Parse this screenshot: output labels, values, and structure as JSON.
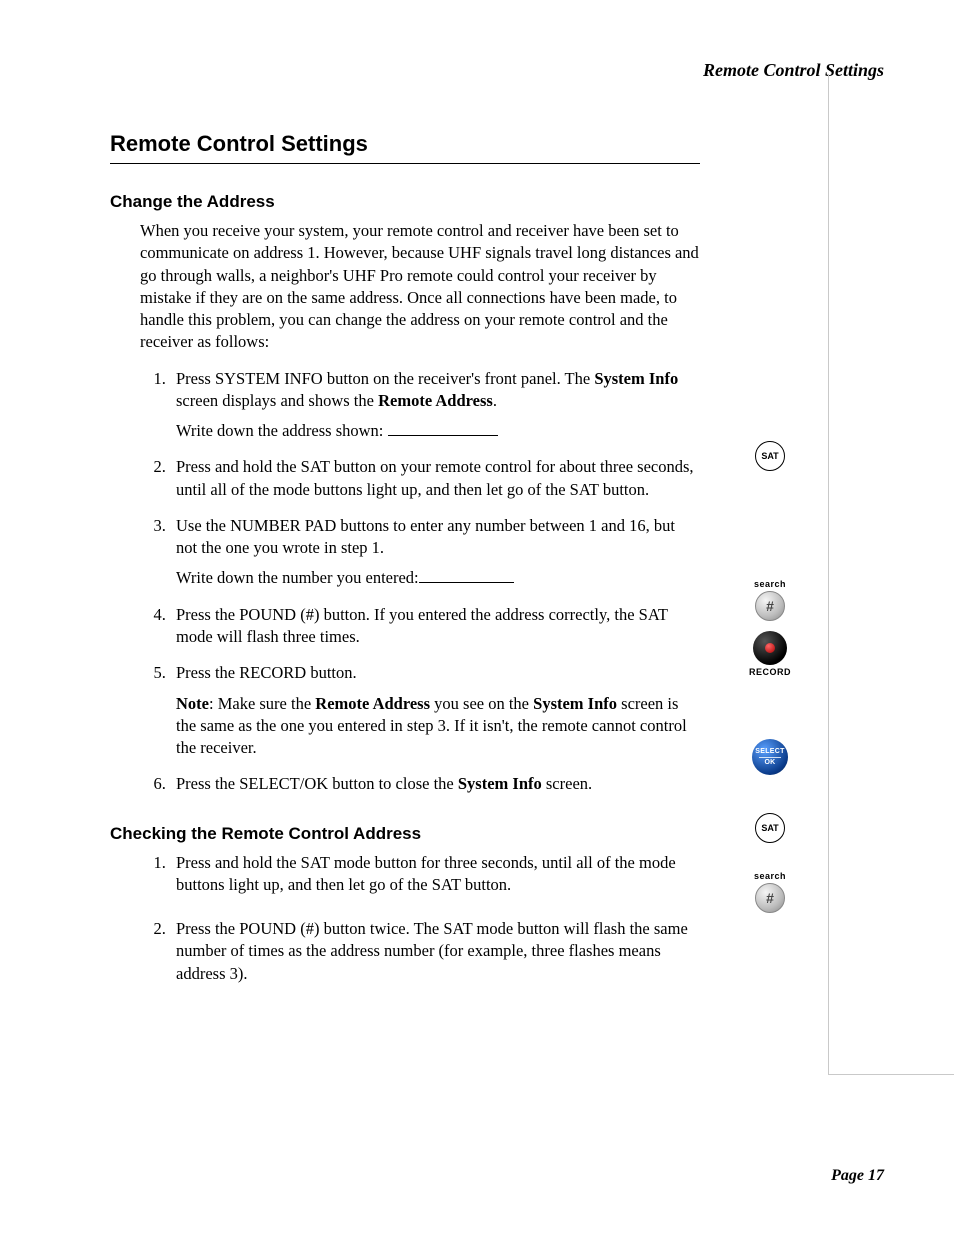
{
  "header": {
    "running": "Remote Control Settings"
  },
  "title": "Remote Control Settings",
  "section1": {
    "heading": "Change the Address",
    "intro": "When you receive your system, your remote control and receiver have been set to communicate on address 1. However, because UHF signals travel long distances and go through walls, a neighbor's UHF Pro remote could control your receiver by mistake if they are on the same address. Once all connections have been made, to handle this problem, you can change the address on your remote control and the receiver as follows:",
    "steps": {
      "s1a": "Press ",
      "s1_sc1": "SYSTEM INFO",
      "s1b": " button on the receiver's front panel. The ",
      "s1_b1": "System Info",
      "s1c": " screen displays and shows the ",
      "s1_b2": "Remote Address",
      "s1d": ".",
      "s1_write": "Write down the address shown: ",
      "s2a": "Press and hold the ",
      "s2_sc1": "SAT",
      "s2b": " button on your remote control for about three seconds, until all of the mode buttons light up, and then let go of the ",
      "s2_sc2": "SAT",
      "s2c": " button.",
      "s3a": "Use the ",
      "s3_sc1": "NUMBER PAD",
      "s3b": " buttons to enter any number between 1 and 16, but not the one you wrote in step 1.",
      "s3_write": "Write down the number you entered:",
      "s4a": "Press the ",
      "s4_sc1": "POUND (#)",
      "s4b": " button. If you entered the address correctly, the ",
      "s4_sc2": "SAT",
      "s4c": " mode will flash three times.",
      "s5a": "Press the ",
      "s5_sc1": "RECORD",
      "s5b": " button.",
      "s5_note_label": "Note",
      "s5_note_a": ": Make sure the ",
      "s5_note_b1": "Remote Address",
      "s5_note_b": " you see on the ",
      "s5_note_b2": "System Info",
      "s5_note_c": " screen is the same as the one you entered in step 3. If it isn't, the remote cannot control the receiver.",
      "s6a": "Press the ",
      "s6_sc1": "SELECT/OK",
      "s6b": " button to close the ",
      "s6_b1": "System Info",
      "s6c": " screen."
    }
  },
  "section2": {
    "heading": "Checking the Remote Control Address",
    "steps": {
      "s1a": "Press and hold the ",
      "s1_sc1": "SAT",
      "s1b": " mode button for three seconds, until all of the mode buttons light up, and then let go of the ",
      "s1_sc2": "SAT",
      "s1c": " button.",
      "s2a": "Press the ",
      "s2_sc1": "POUND (#)",
      "s2b": " button twice. The ",
      "s2_sc2": "SAT",
      "s2c": " mode button will flash the same number of times as the address number (for example, three flashes means address 3)."
    }
  },
  "icons": {
    "sat": "SAT",
    "search": "search",
    "pound": "#",
    "record": "RECORD",
    "select_top": "SELECT",
    "select_bottom": "OK"
  },
  "footer": {
    "page": "Page 17"
  }
}
